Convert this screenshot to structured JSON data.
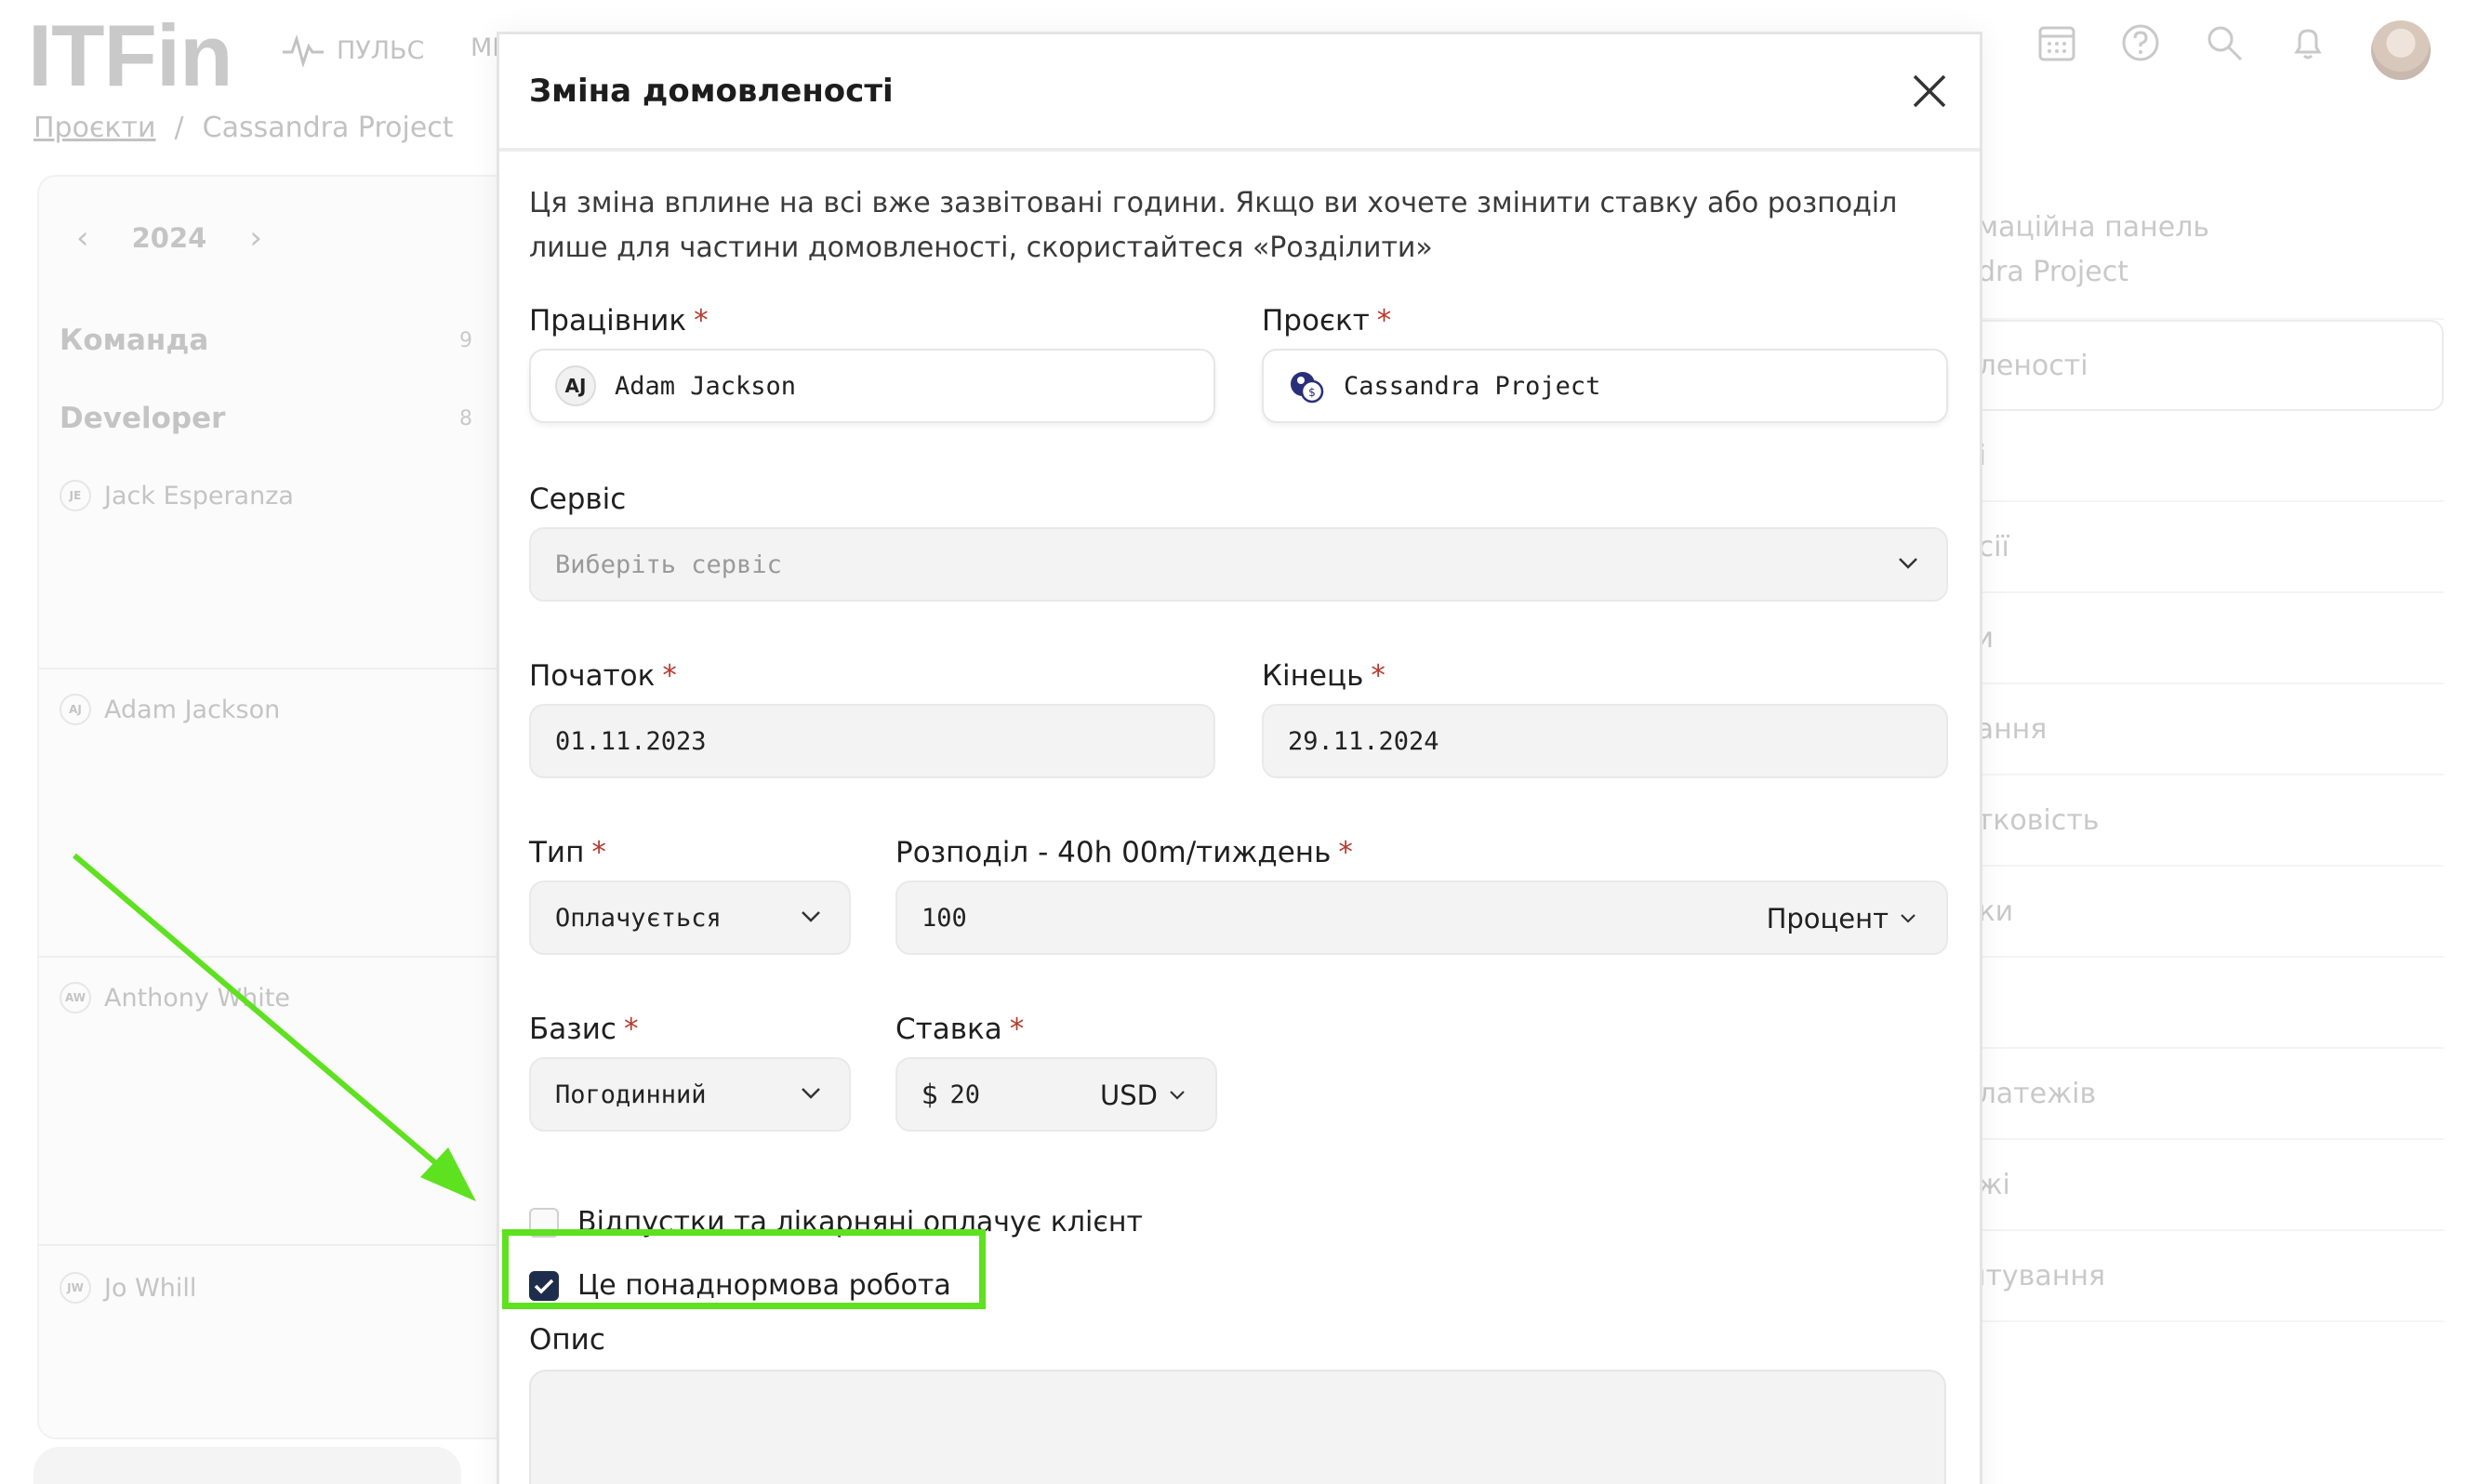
{
  "app": {
    "logo": "ITFin",
    "nav_pulse": "ПУЛЬС",
    "nav_partial": "МІ"
  },
  "breadcrumb": {
    "projects": "Проєкти",
    "separator": "/",
    "current": "Cassandra Project"
  },
  "team_panel": {
    "year": "2024",
    "groups": [
      {
        "name": "Команда",
        "count": "9"
      },
      {
        "name": "Developer",
        "count": "8"
      }
    ],
    "people": [
      {
        "initials": "JE",
        "name": "Jack Esperanza"
      },
      {
        "initials": "AJ",
        "name": "Adam Jackson"
      },
      {
        "initials": "AW",
        "name": "Anthony White"
      },
      {
        "initials": "JW",
        "name": "Jo Whill"
      }
    ]
  },
  "right_nav": {
    "items": [
      "омаційна панель\nndra Project",
      "вленості",
      "ні",
      "нсії",
      "си",
      "вання",
      "утковість",
      "ики",
      "",
      "платежів",
      "ежі",
      "штування"
    ]
  },
  "modal": {
    "title": "Зміна домовленості",
    "note": "Ця зміна вплине на всі вже зазвітовані години. Якщо ви хочете змінити ставку або розподіл лише для частини домовленості, скористайтеся «Розділити»",
    "employee": {
      "label": "Працівник",
      "required": "*",
      "initials": "AJ",
      "value": "Adam Jackson"
    },
    "project": {
      "label": "Проєкт",
      "required": "*",
      "value": "Cassandra Project"
    },
    "service": {
      "label": "Сервіс",
      "placeholder": "Виберіть сервіс"
    },
    "start": {
      "label": "Початок",
      "required": "*",
      "value": "01.11.2023"
    },
    "end": {
      "label": "Кінець",
      "required": "*",
      "value": "29.11.2024"
    },
    "type": {
      "label": "Тип",
      "required": "*",
      "value": "Оплачується"
    },
    "distribution": {
      "label": "Розподіл - 40h 00m/тиждень",
      "required": "*",
      "value": "100",
      "unit": "Процент"
    },
    "basis": {
      "label": "Базис",
      "required": "*",
      "value": "Погодинний"
    },
    "rate": {
      "label": "Ставка",
      "required": "*",
      "symbol": "$",
      "value": "20",
      "currency": "USD"
    },
    "checkbox_vacation": {
      "label": "Відпустки та лікарняні оплачує клієнт",
      "checked": false
    },
    "checkbox_overtime": {
      "label": "Це понаднормова робота",
      "checked": true
    },
    "description": {
      "label": "Опис"
    }
  },
  "colors": {
    "highlight": "#5ee11f",
    "required_star": "#b73a2f",
    "checkbox_on": "#1f2d4d"
  }
}
